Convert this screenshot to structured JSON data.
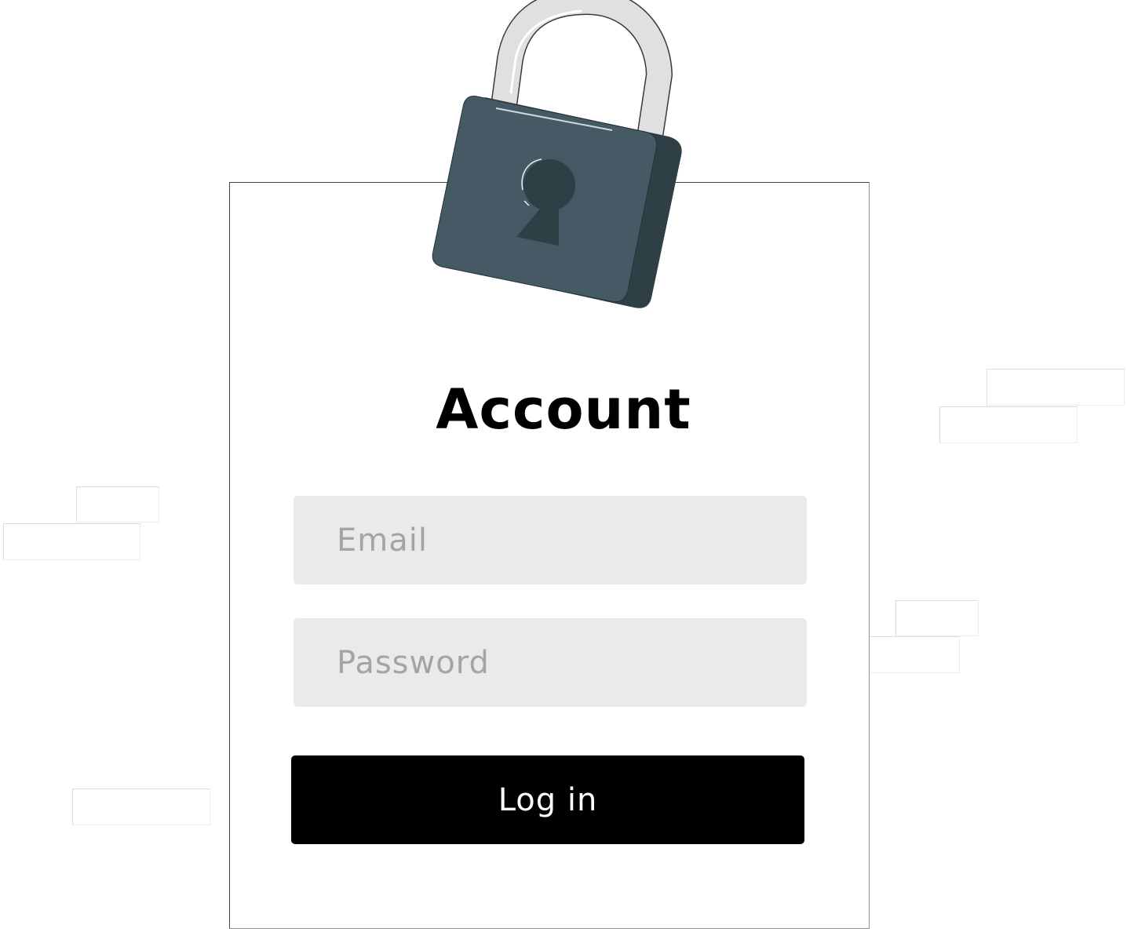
{
  "background_color": "#ffffff",
  "title": "Account",
  "email_field": {
    "placeholder": "Email"
  },
  "password_field": {
    "placeholder": "Password"
  },
  "login_button": {
    "label": "Log in",
    "color": "#000000",
    "text_color": "#ffffff"
  },
  "field_background": "#eaeaea",
  "lock_icon": {
    "name": "padlock-icon",
    "body_color": "#455a64",
    "side_color": "#2f3f46",
    "shackle_color": "#e0e0e0"
  }
}
